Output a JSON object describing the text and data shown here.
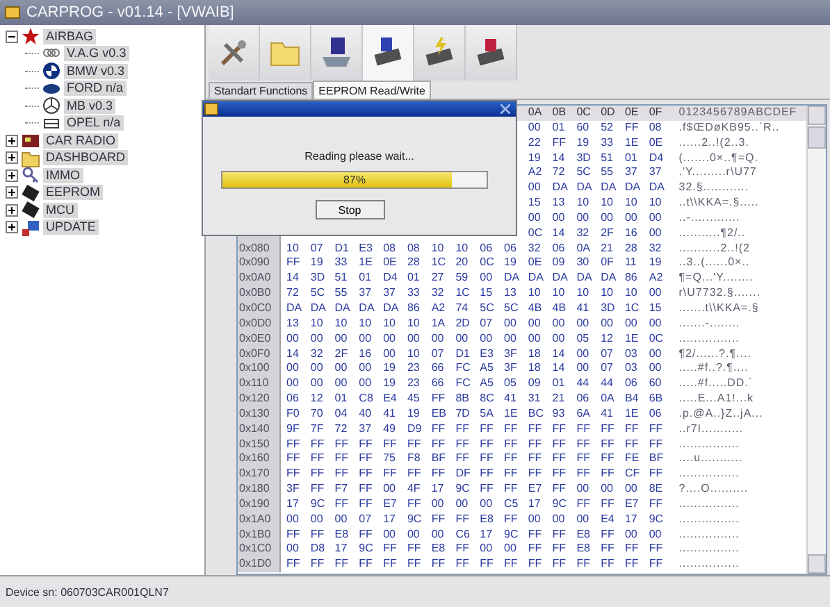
{
  "window": {
    "title": "CARPROG - v01.14 - [VWAIB]"
  },
  "tree": [
    {
      "label": "AIRBAG",
      "kind": "star",
      "expanded": true,
      "children": [
        {
          "label": "V.A.G v0.3",
          "kind": "rings"
        },
        {
          "label": "BMW v0.3",
          "kind": "roundel"
        },
        {
          "label": "FORD n/a",
          "kind": "oval"
        },
        {
          "label": "MB v0.3",
          "kind": "tristar"
        },
        {
          "label": "OPEL n/a",
          "kind": "grille"
        }
      ]
    },
    {
      "label": "CAR RADIO",
      "kind": "radio",
      "expanded": false
    },
    {
      "label": "DASHBOARD",
      "kind": "folder",
      "expanded": false
    },
    {
      "label": "IMMO",
      "kind": "key",
      "expanded": false
    },
    {
      "label": "EEPROM",
      "kind": "chip",
      "expanded": false
    },
    {
      "label": "MCU",
      "kind": "chip",
      "expanded": false
    },
    {
      "label": "UPDATE",
      "kind": "update",
      "expanded": false
    }
  ],
  "toolbar": [
    {
      "kind": "tools",
      "selected": false
    },
    {
      "kind": "folder",
      "selected": false
    },
    {
      "kind": "disk",
      "selected": false
    },
    {
      "kind": "chipread",
      "selected": true
    },
    {
      "kind": "chipwrite",
      "selected": false
    },
    {
      "kind": "chiphelp",
      "selected": false
    }
  ],
  "tabs": [
    {
      "label": "Standart Functions",
      "selected": false
    },
    {
      "label": "EEPROM Read/Write",
      "selected": true
    }
  ],
  "hex_view": {
    "header_columns": [
      "0A",
      "0B",
      "0C",
      "0D",
      "0E",
      "0F"
    ],
    "ascii_header": "0123456789ABCDEF",
    "rows": [
      {
        "bytes": [
          "00",
          "01",
          "60",
          "52",
          "FF",
          "08"
        ],
        "ascii": ".f$ŒDøKB95..`R.."
      },
      {
        "bytes": [
          "22",
          "FF",
          "19",
          "33",
          "1E",
          "0E"
        ],
        "ascii": "......2..!(2..3."
      },
      {
        "bytes": [
          "19",
          "14",
          "3D",
          "51",
          "01",
          "D4"
        ],
        "ascii": "(.......0×..¶=Q."
      },
      {
        "bytes": [
          "A2",
          "72",
          "5C",
          "55",
          "37",
          "37"
        ],
        "ascii": ".'Y.........r\\U77"
      },
      {
        "bytes": [
          "00",
          "DA",
          "DA",
          "DA",
          "DA",
          "DA"
        ],
        "ascii": "32.§............"
      },
      {
        "bytes": [
          "15",
          "13",
          "10",
          "10",
          "10",
          "10"
        ],
        "ascii": "..t\\\\KKA=.§....."
      },
      {
        "bytes": [
          "00",
          "00",
          "00",
          "00",
          "00",
          "00"
        ],
        "ascii": "..-............."
      },
      {
        "bytes": [
          "0C",
          "14",
          "32",
          "2F",
          "16",
          "00"
        ],
        "ascii": "...........¶2/.."
      },
      {
        "offset": "0x080",
        "bytes": [
          "10",
          "07",
          "D1",
          "E3",
          "08",
          "08",
          "10",
          "10",
          "06",
          "06",
          "32",
          "06",
          "0A",
          "21",
          "28",
          "32"
        ],
        "ascii": "...........2..!(2"
      },
      {
        "offset": "0x090",
        "bytes": [
          "FF",
          "19",
          "33",
          "1E",
          "0E",
          "28",
          "1C",
          "20",
          "0C",
          "19",
          "0E",
          "09",
          "30",
          "0F",
          "11",
          "19"
        ],
        "ascii": "..3..(......0×.."
      },
      {
        "offset": "0x0A0",
        "bytes": [
          "14",
          "3D",
          "51",
          "01",
          "D4",
          "01",
          "27",
          "59",
          "00",
          "DA",
          "DA",
          "DA",
          "DA",
          "DA",
          "86",
          "A2"
        ],
        "ascii": "¶=Q...'Y........"
      },
      {
        "offset": "0x0B0",
        "bytes": [
          "72",
          "5C",
          "55",
          "37",
          "37",
          "33",
          "32",
          "1C",
          "15",
          "13",
          "10",
          "10",
          "10",
          "10",
          "10",
          "00"
        ],
        "ascii": "r\\U7732.§......."
      },
      {
        "offset": "0x0C0",
        "bytes": [
          "DA",
          "DA",
          "DA",
          "DA",
          "DA",
          "86",
          "A2",
          "74",
          "5C",
          "5C",
          "4B",
          "4B",
          "41",
          "3D",
          "1C",
          "15"
        ],
        "ascii": ".......t\\\\KKA=.§"
      },
      {
        "offset": "0x0D0",
        "bytes": [
          "13",
          "10",
          "10",
          "10",
          "10",
          "10",
          "1A",
          "2D",
          "07",
          "00",
          "00",
          "00",
          "00",
          "00",
          "00",
          "00"
        ],
        "ascii": ".......-........"
      },
      {
        "offset": "0x0E0",
        "bytes": [
          "00",
          "00",
          "00",
          "00",
          "00",
          "00",
          "00",
          "00",
          "00",
          "00",
          "00",
          "00",
          "05",
          "12",
          "1E",
          "0C"
        ],
        "ascii": "................"
      },
      {
        "offset": "0x0F0",
        "bytes": [
          "14",
          "32",
          "2F",
          "16",
          "00",
          "10",
          "07",
          "D1",
          "E3",
          "3F",
          "18",
          "14",
          "00",
          "07",
          "03",
          "00"
        ],
        "ascii": "¶2/......?.¶...."
      },
      {
        "offset": "0x100",
        "bytes": [
          "00",
          "00",
          "00",
          "00",
          "19",
          "23",
          "66",
          "FC",
          "A5",
          "3F",
          "18",
          "14",
          "00",
          "07",
          "03",
          "00"
        ],
        "ascii": ".....#f..?.¶...."
      },
      {
        "offset": "0x110",
        "bytes": [
          "00",
          "00",
          "00",
          "00",
          "19",
          "23",
          "66",
          "FC",
          "A5",
          "05",
          "09",
          "01",
          "44",
          "44",
          "06",
          "60"
        ],
        "ascii": ".....#f.....DD.`"
      },
      {
        "offset": "0x120",
        "bytes": [
          "06",
          "12",
          "01",
          "C8",
          "E4",
          "45",
          "FF",
          "8B",
          "8C",
          "41",
          "31",
          "21",
          "06",
          "0A",
          "B4",
          "6B"
        ],
        "ascii": ".....E...A1!...k"
      },
      {
        "offset": "0x130",
        "bytes": [
          "F0",
          "70",
          "04",
          "40",
          "41",
          "19",
          "EB",
          "7D",
          "5A",
          "1E",
          "BC",
          "93",
          "6A",
          "41",
          "1E",
          "06"
        ],
        "ascii": ".p.@A..}Z..jA..."
      },
      {
        "offset": "0x140",
        "bytes": [
          "9F",
          "7F",
          "72",
          "37",
          "49",
          "D9",
          "FF",
          "FF",
          "FF",
          "FF",
          "FF",
          "FF",
          "FF",
          "FF",
          "FF",
          "FF"
        ],
        "ascii": "..r7I..........."
      },
      {
        "offset": "0x150",
        "bytes": [
          "FF",
          "FF",
          "FF",
          "FF",
          "FF",
          "FF",
          "FF",
          "FF",
          "FF",
          "FF",
          "FF",
          "FF",
          "FF",
          "FF",
          "FF",
          "FF"
        ],
        "ascii": "................"
      },
      {
        "offset": "0x160",
        "bytes": [
          "FF",
          "FF",
          "FF",
          "FF",
          "75",
          "F8",
          "BF",
          "FF",
          "FF",
          "FF",
          "FF",
          "FF",
          "FF",
          "FF",
          "FE",
          "BF"
        ],
        "ascii": "....u..........."
      },
      {
        "offset": "0x170",
        "bytes": [
          "FF",
          "FF",
          "FF",
          "FF",
          "FF",
          "FF",
          "FF",
          "DF",
          "FF",
          "FF",
          "FF",
          "FF",
          "FF",
          "FF",
          "CF",
          "FF"
        ],
        "ascii": "................"
      },
      {
        "offset": "0x180",
        "bytes": [
          "3F",
          "FF",
          "F7",
          "FF",
          "00",
          "4F",
          "17",
          "9C",
          "FF",
          "FF",
          "E7",
          "FF",
          "00",
          "00",
          "00",
          "8E"
        ],
        "ascii": "?....O.........."
      },
      {
        "offset": "0x190",
        "bytes": [
          "17",
          "9C",
          "FF",
          "FF",
          "E7",
          "FF",
          "00",
          "00",
          "00",
          "C5",
          "17",
          "9C",
          "FF",
          "FF",
          "E7",
          "FF"
        ],
        "ascii": "................"
      },
      {
        "offset": "0x1A0",
        "bytes": [
          "00",
          "00",
          "00",
          "07",
          "17",
          "9C",
          "FF",
          "FF",
          "E8",
          "FF",
          "00",
          "00",
          "00",
          "E4",
          "17",
          "9C"
        ],
        "ascii": "................"
      },
      {
        "offset": "0x1B0",
        "bytes": [
          "FF",
          "FF",
          "E8",
          "FF",
          "00",
          "00",
          "00",
          "C6",
          "17",
          "9C",
          "FF",
          "FF",
          "E8",
          "FF",
          "00",
          "00"
        ],
        "ascii": "................"
      },
      {
        "offset": "0x1C0",
        "bytes": [
          "00",
          "D8",
          "17",
          "9C",
          "FF",
          "FF",
          "E8",
          "FF",
          "00",
          "00",
          "FF",
          "FF",
          "E8",
          "FF",
          "FF",
          "FF"
        ],
        "ascii": "................"
      },
      {
        "offset": "0x1D0",
        "bytes": [
          "FF",
          "FF",
          "FF",
          "FF",
          "FF",
          "FF",
          "FF",
          "FF",
          "FF",
          "FF",
          "FF",
          "FF",
          "FF",
          "FF",
          "FF",
          "FF"
        ],
        "ascii": "................"
      }
    ]
  },
  "dialog": {
    "message": "Reading please wait...",
    "progress": {
      "level": 0.87,
      "reading": "87%"
    },
    "button": "Stop"
  },
  "status_bar": {
    "text": "Device sn: 060703CAR001QLN7"
  }
}
